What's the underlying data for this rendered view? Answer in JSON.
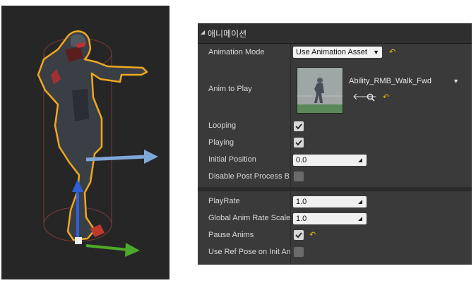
{
  "details": {
    "section_title": "애니메이션",
    "rows": {
      "animation_mode": {
        "label": "Animation Mode",
        "value": "Use Animation Asset"
      },
      "anim_to_play": {
        "label": "Anim to Play",
        "value": "Ability_RMB_Walk_Fwd"
      },
      "looping": {
        "label": "Looping",
        "checked": true
      },
      "playing": {
        "label": "Playing",
        "checked": true
      },
      "initial_position": {
        "label": "Initial Position",
        "value": "0.0"
      },
      "disable_post_process": {
        "label": "Disable Post Process B",
        "checked": false
      },
      "play_rate": {
        "label": "PlayRate",
        "value": "1.0"
      },
      "global_anim_rate_scale": {
        "label": "Global Anim Rate Scale",
        "value": "1.0"
      },
      "pause_anims": {
        "label": "Pause Anims",
        "checked": true
      },
      "use_ref_pose": {
        "label": "Use Ref Pose on Init An",
        "checked": false
      }
    }
  },
  "icons": {
    "reset": "reset-arrow-icon",
    "use_selected": "left-arrow-icon",
    "browse": "search-icon",
    "checkbox_check": "checkmark-icon",
    "drag": "drag-handle-icon"
  },
  "colors": {
    "panel_bg": "#3a3a3a",
    "viewport_bg": "#262626",
    "selection_outline": "#f0a81e",
    "reset_yellow": "#e6c200"
  }
}
